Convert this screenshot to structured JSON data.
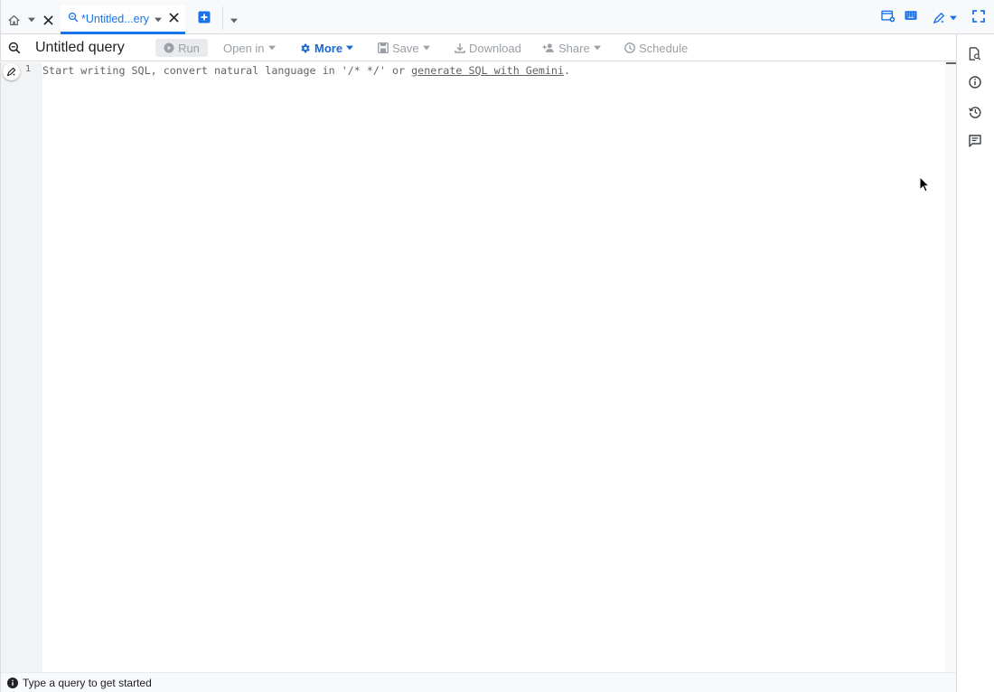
{
  "tabs": {
    "home_icon": "home-icon",
    "active_tab_label": "*Untitled...ery",
    "active_tab_icon": "query-icon"
  },
  "toolbar": {
    "title": "Untitled query",
    "run_label": "Run",
    "open_in_label": "Open in",
    "more_label": "More",
    "save_label": "Save",
    "download_label": "Download",
    "share_label": "Share",
    "schedule_label": "Schedule"
  },
  "editor": {
    "line_number": "1",
    "placeholder_prefix": "Start writing SQL, convert natural language in '/* */' or ",
    "placeholder_link": "generate SQL with Gemini",
    "placeholder_suffix": "."
  },
  "status": {
    "message": "Type a query to get started"
  },
  "colors": {
    "accent": "#1a73e8",
    "more_text": "#1967d2",
    "disabled_text": "#9aa0a6",
    "chrome_bg": "#f8f9fa",
    "gutter_bg": "#f1f3f4"
  }
}
